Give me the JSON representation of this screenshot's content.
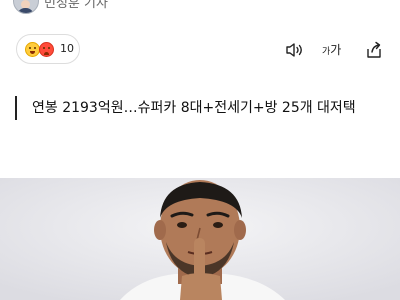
{
  "author": {
    "name": "민정훈 기자"
  },
  "toolbar": {
    "reaction_count": "10",
    "font_size_label_small": "가",
    "font_size_label_large": "가"
  },
  "article": {
    "headline": "연봉 2193억원…슈퍼카 8대+전세기+방 25개 대저택"
  },
  "colors": {
    "background": "#ffffff",
    "border": "#dddddd",
    "headline_bar": "#222222"
  }
}
